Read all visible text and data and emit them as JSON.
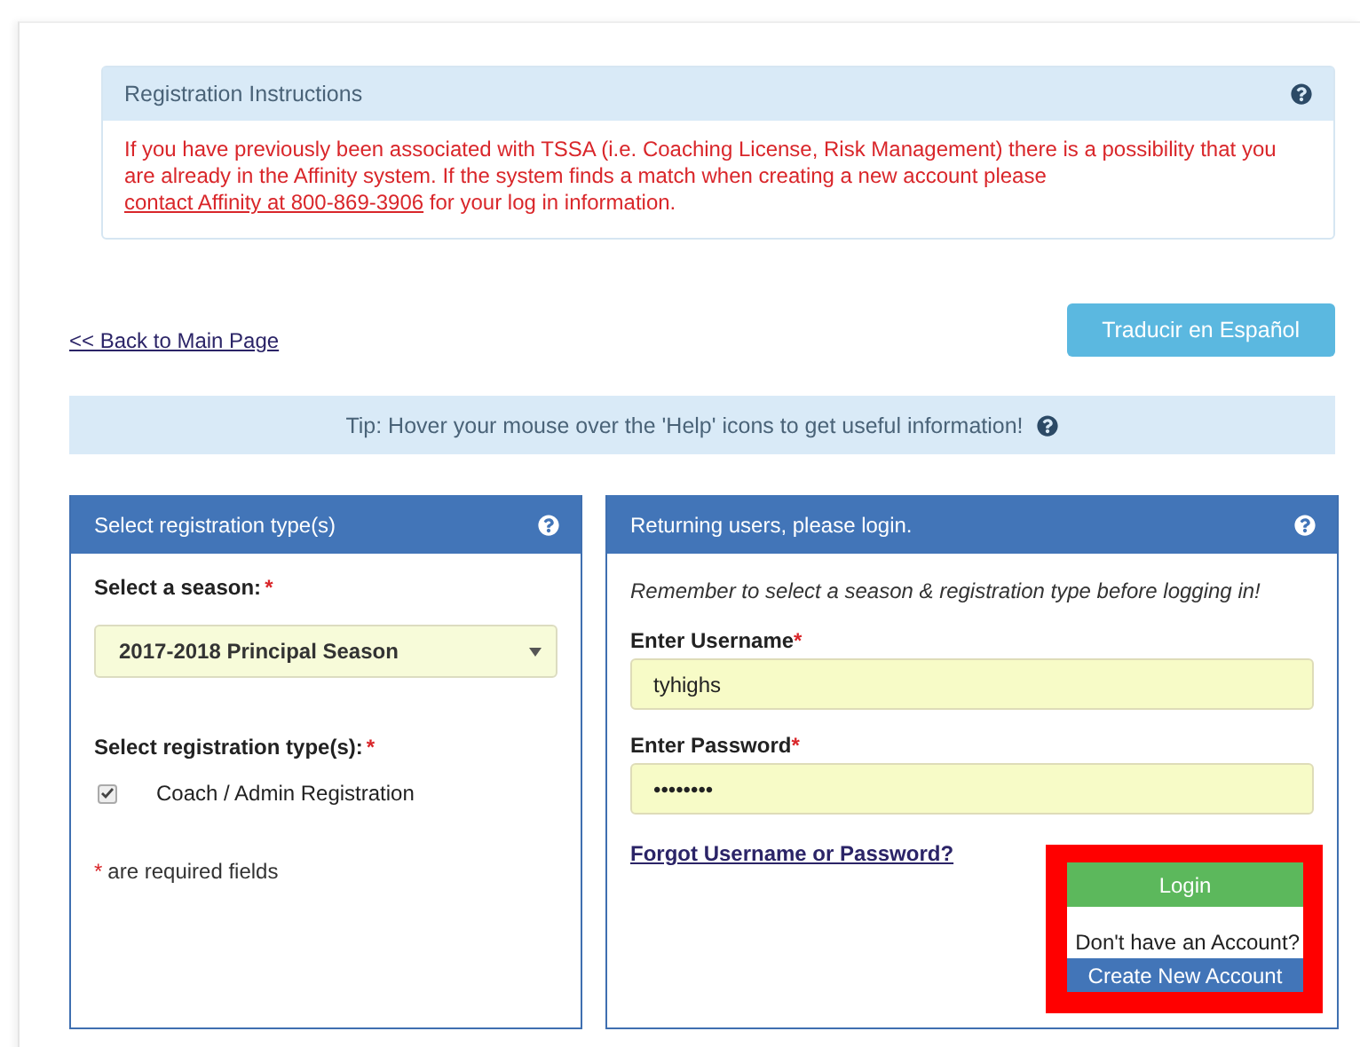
{
  "instructions": {
    "title": "Registration Instructions",
    "text_before": "If you have previously been associated with TSSA (i.e. Coaching License, Risk Management) there is a possibility that you are already in the Affinity system. If the system finds a match when creating a new account please ",
    "link": "contact Affinity at 800-869-3906",
    "text_after": " for your log in information."
  },
  "back_link": "<< Back to Main Page",
  "translate_button": "Traducir en Español",
  "tip": "Tip: Hover your mouse over the 'Help' icons to get useful information!",
  "registration_panel": {
    "title": "Select registration type(s)",
    "season_label": {
      "text": "Select a season:",
      "mark": "*"
    },
    "season_value": "2017-2018 Principal Season",
    "types_label": {
      "text": "Select registration type(s):",
      "mark": "*"
    },
    "types": [
      {
        "label": "Coach / Admin Registration",
        "checked": true
      }
    ],
    "required_note": {
      "mark": "*",
      "text": "are required fields"
    }
  },
  "login_panel": {
    "title": "Returning users, please login.",
    "reminder": "Remember to select a season & registration type before logging in!",
    "username": {
      "label": "Enter Username",
      "mark": "*",
      "value": "tyhighs"
    },
    "password": {
      "label": "Enter Password",
      "mark": "*",
      "value": "••••••••"
    },
    "forgot_link": "Forgot Username or Password?",
    "login_button": "Login",
    "no_account": "Don't have an Account?",
    "create_button": "Create New Account"
  }
}
